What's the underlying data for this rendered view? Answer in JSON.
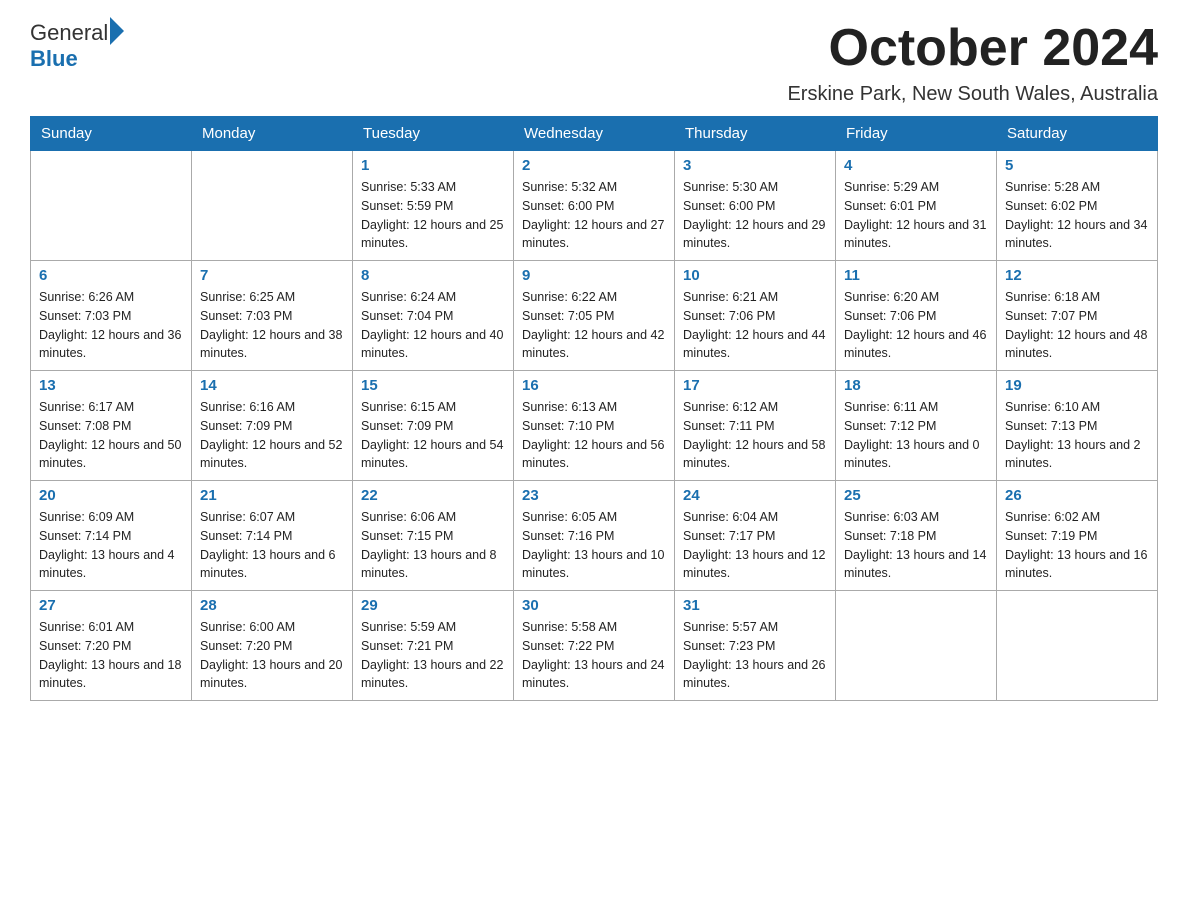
{
  "header": {
    "logo_general": "General",
    "logo_blue": "Blue",
    "month_title": "October 2024",
    "location": "Erskine Park, New South Wales, Australia"
  },
  "weekdays": [
    "Sunday",
    "Monday",
    "Tuesday",
    "Wednesday",
    "Thursday",
    "Friday",
    "Saturday"
  ],
  "weeks": [
    [
      {
        "day": "",
        "sunrise": "",
        "sunset": "",
        "daylight": ""
      },
      {
        "day": "",
        "sunrise": "",
        "sunset": "",
        "daylight": ""
      },
      {
        "day": "1",
        "sunrise": "Sunrise: 5:33 AM",
        "sunset": "Sunset: 5:59 PM",
        "daylight": "Daylight: 12 hours and 25 minutes."
      },
      {
        "day": "2",
        "sunrise": "Sunrise: 5:32 AM",
        "sunset": "Sunset: 6:00 PM",
        "daylight": "Daylight: 12 hours and 27 minutes."
      },
      {
        "day": "3",
        "sunrise": "Sunrise: 5:30 AM",
        "sunset": "Sunset: 6:00 PM",
        "daylight": "Daylight: 12 hours and 29 minutes."
      },
      {
        "day": "4",
        "sunrise": "Sunrise: 5:29 AM",
        "sunset": "Sunset: 6:01 PM",
        "daylight": "Daylight: 12 hours and 31 minutes."
      },
      {
        "day": "5",
        "sunrise": "Sunrise: 5:28 AM",
        "sunset": "Sunset: 6:02 PM",
        "daylight": "Daylight: 12 hours and 34 minutes."
      }
    ],
    [
      {
        "day": "6",
        "sunrise": "Sunrise: 6:26 AM",
        "sunset": "Sunset: 7:03 PM",
        "daylight": "Daylight: 12 hours and 36 minutes."
      },
      {
        "day": "7",
        "sunrise": "Sunrise: 6:25 AM",
        "sunset": "Sunset: 7:03 PM",
        "daylight": "Daylight: 12 hours and 38 minutes."
      },
      {
        "day": "8",
        "sunrise": "Sunrise: 6:24 AM",
        "sunset": "Sunset: 7:04 PM",
        "daylight": "Daylight: 12 hours and 40 minutes."
      },
      {
        "day": "9",
        "sunrise": "Sunrise: 6:22 AM",
        "sunset": "Sunset: 7:05 PM",
        "daylight": "Daylight: 12 hours and 42 minutes."
      },
      {
        "day": "10",
        "sunrise": "Sunrise: 6:21 AM",
        "sunset": "Sunset: 7:06 PM",
        "daylight": "Daylight: 12 hours and 44 minutes."
      },
      {
        "day": "11",
        "sunrise": "Sunrise: 6:20 AM",
        "sunset": "Sunset: 7:06 PM",
        "daylight": "Daylight: 12 hours and 46 minutes."
      },
      {
        "day": "12",
        "sunrise": "Sunrise: 6:18 AM",
        "sunset": "Sunset: 7:07 PM",
        "daylight": "Daylight: 12 hours and 48 minutes."
      }
    ],
    [
      {
        "day": "13",
        "sunrise": "Sunrise: 6:17 AM",
        "sunset": "Sunset: 7:08 PM",
        "daylight": "Daylight: 12 hours and 50 minutes."
      },
      {
        "day": "14",
        "sunrise": "Sunrise: 6:16 AM",
        "sunset": "Sunset: 7:09 PM",
        "daylight": "Daylight: 12 hours and 52 minutes."
      },
      {
        "day": "15",
        "sunrise": "Sunrise: 6:15 AM",
        "sunset": "Sunset: 7:09 PM",
        "daylight": "Daylight: 12 hours and 54 minutes."
      },
      {
        "day": "16",
        "sunrise": "Sunrise: 6:13 AM",
        "sunset": "Sunset: 7:10 PM",
        "daylight": "Daylight: 12 hours and 56 minutes."
      },
      {
        "day": "17",
        "sunrise": "Sunrise: 6:12 AM",
        "sunset": "Sunset: 7:11 PM",
        "daylight": "Daylight: 12 hours and 58 minutes."
      },
      {
        "day": "18",
        "sunrise": "Sunrise: 6:11 AM",
        "sunset": "Sunset: 7:12 PM",
        "daylight": "Daylight: 13 hours and 0 minutes."
      },
      {
        "day": "19",
        "sunrise": "Sunrise: 6:10 AM",
        "sunset": "Sunset: 7:13 PM",
        "daylight": "Daylight: 13 hours and 2 minutes."
      }
    ],
    [
      {
        "day": "20",
        "sunrise": "Sunrise: 6:09 AM",
        "sunset": "Sunset: 7:14 PM",
        "daylight": "Daylight: 13 hours and 4 minutes."
      },
      {
        "day": "21",
        "sunrise": "Sunrise: 6:07 AM",
        "sunset": "Sunset: 7:14 PM",
        "daylight": "Daylight: 13 hours and 6 minutes."
      },
      {
        "day": "22",
        "sunrise": "Sunrise: 6:06 AM",
        "sunset": "Sunset: 7:15 PM",
        "daylight": "Daylight: 13 hours and 8 minutes."
      },
      {
        "day": "23",
        "sunrise": "Sunrise: 6:05 AM",
        "sunset": "Sunset: 7:16 PM",
        "daylight": "Daylight: 13 hours and 10 minutes."
      },
      {
        "day": "24",
        "sunrise": "Sunrise: 6:04 AM",
        "sunset": "Sunset: 7:17 PM",
        "daylight": "Daylight: 13 hours and 12 minutes."
      },
      {
        "day": "25",
        "sunrise": "Sunrise: 6:03 AM",
        "sunset": "Sunset: 7:18 PM",
        "daylight": "Daylight: 13 hours and 14 minutes."
      },
      {
        "day": "26",
        "sunrise": "Sunrise: 6:02 AM",
        "sunset": "Sunset: 7:19 PM",
        "daylight": "Daylight: 13 hours and 16 minutes."
      }
    ],
    [
      {
        "day": "27",
        "sunrise": "Sunrise: 6:01 AM",
        "sunset": "Sunset: 7:20 PM",
        "daylight": "Daylight: 13 hours and 18 minutes."
      },
      {
        "day": "28",
        "sunrise": "Sunrise: 6:00 AM",
        "sunset": "Sunset: 7:20 PM",
        "daylight": "Daylight: 13 hours and 20 minutes."
      },
      {
        "day": "29",
        "sunrise": "Sunrise: 5:59 AM",
        "sunset": "Sunset: 7:21 PM",
        "daylight": "Daylight: 13 hours and 22 minutes."
      },
      {
        "day": "30",
        "sunrise": "Sunrise: 5:58 AM",
        "sunset": "Sunset: 7:22 PM",
        "daylight": "Daylight: 13 hours and 24 minutes."
      },
      {
        "day": "31",
        "sunrise": "Sunrise: 5:57 AM",
        "sunset": "Sunset: 7:23 PM",
        "daylight": "Daylight: 13 hours and 26 minutes."
      },
      {
        "day": "",
        "sunrise": "",
        "sunset": "",
        "daylight": ""
      },
      {
        "day": "",
        "sunrise": "",
        "sunset": "",
        "daylight": ""
      }
    ]
  ]
}
